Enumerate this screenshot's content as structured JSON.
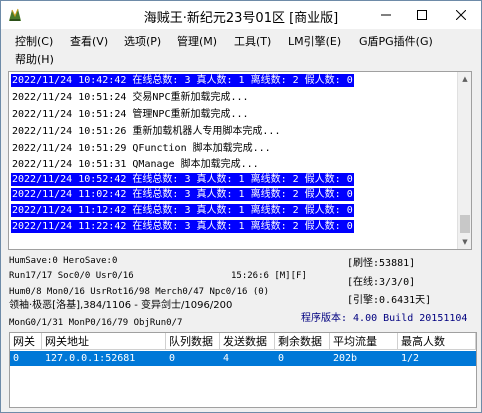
{
  "window": {
    "title": "海贼王·新纪元23号01区 [商业版]"
  },
  "menu": {
    "items": [
      "控制(C)",
      "查看(V)",
      "选项(P)",
      "管理(M)",
      "工具(T)",
      "LM引擎(E)",
      "G盾PG插件(G)",
      "帮助(H)"
    ]
  },
  "log": {
    "lines": [
      {
        "text": "2022/11/24 10:42:42 在线总数: 3 真人数: 1 离线数: 2 假人数: 0",
        "highlight": true
      },
      {
        "text": "2022/11/24 10:51:24 交易NPC重新加载完成...",
        "highlight": false
      },
      {
        "text": "2022/11/24 10:51:24 管理NPC重新加载完成...",
        "highlight": false
      },
      {
        "text": "2022/11/24 10:51:26 重新加载机器人专用脚本完成...",
        "highlight": false
      },
      {
        "text": "2022/11/24 10:51:29 QFunction 脚本加载完成...",
        "highlight": false
      },
      {
        "text": "2022/11/24 10:51:31 QManage 脚本加载完成...",
        "highlight": false
      },
      {
        "text": "2022/11/24 10:52:42 在线总数: 3 真人数: 1 离线数: 2 假人数: 0",
        "highlight": true
      },
      {
        "text": "2022/11/24 11:02:42 在线总数: 3 真人数: 1 离线数: 2 假人数: 0",
        "highlight": true
      },
      {
        "text": "2022/11/24 11:12:42 在线总数: 3 真人数: 1 离线数: 2 假人数: 0",
        "highlight": true
      },
      {
        "text": "2022/11/24 11:22:42 在线总数: 3 真人数: 1 离线数: 2 假人数: 0",
        "highlight": true
      }
    ]
  },
  "status": {
    "line1": "HumSave:0 HeroSave:0",
    "line2": "Run17/17 Soc0/0 Usr0/16",
    "time": "15:26:6 [M][F]",
    "line3": "Hum0/8 Mon0/16 UsrRot16/98 Merch0/47 Npc0/16 (0)",
    "line4": "领袖·极恶[洛基],384/1106 - 变异剑士/1096/200",
    "line5": "MonG0/1/31 MonP0/16/79 ObjRun0/7",
    "refresh": "[刷怪:53881]",
    "online": "[在线:3/3/0]",
    "engine": "[引擎:0.6431天]",
    "version": "程序版本: 4.00 Build 20151104"
  },
  "gateway_table": {
    "headers": [
      "网关",
      "网关地址",
      "队列数据",
      "发送数据",
      "剩余数据",
      "平均流量",
      "最高人数"
    ],
    "rows": [
      [
        "0",
        "127.0.0.1:52681",
        "0",
        "4",
        "0",
        "202b",
        "1/2"
      ]
    ]
  }
}
